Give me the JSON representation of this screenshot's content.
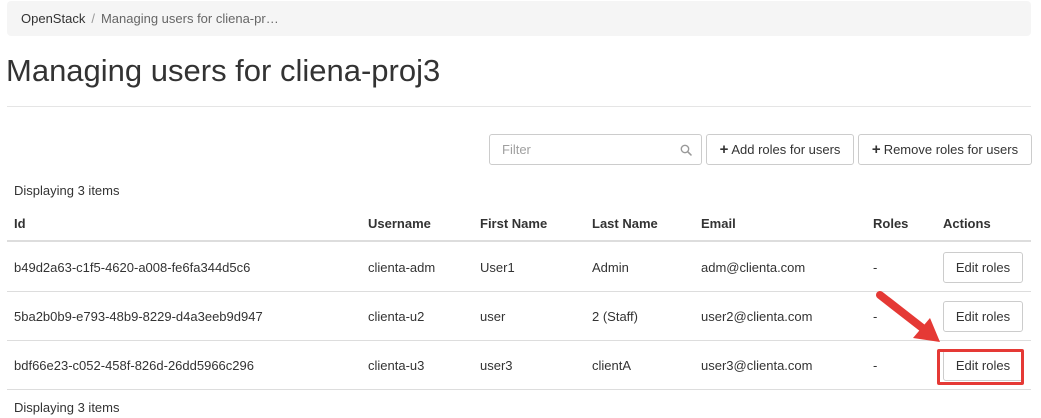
{
  "breadcrumb": {
    "root": "OpenStack",
    "separator": "/",
    "current": "Managing users for cliena-pr…"
  },
  "page_title": "Managing users for cliena-proj3",
  "toolbar": {
    "filter_placeholder": "Filter",
    "search_icon": "search-icon",
    "add_roles_label": "Add roles for users",
    "remove_roles_label": "Remove roles for users",
    "plus_glyph": "+"
  },
  "summary": {
    "top": "Displaying 3 items",
    "bottom": "Displaying 3 items"
  },
  "table": {
    "columns": [
      "Id",
      "Username",
      "First Name",
      "Last Name",
      "Email",
      "Roles",
      "Actions"
    ],
    "rows": [
      {
        "id": "b49d2a63-c1f5-4620-a008-fe6fa344d5c6",
        "username": "clienta-adm",
        "first_name": "User1",
        "last_name": "Admin",
        "email": "adm@clienta.com",
        "roles": "-",
        "action": "Edit roles"
      },
      {
        "id": "5ba2b0b9-e793-48b9-8229-d4a3eeb9d947",
        "username": "clienta-u2",
        "first_name": "user",
        "last_name": "2 (Staff)",
        "email": "user2@clienta.com",
        "roles": "-",
        "action": "Edit roles"
      },
      {
        "id": "bdf66e23-c052-458f-826d-26dd5966c296",
        "username": "clienta-u3",
        "first_name": "user3",
        "last_name": "clientA",
        "email": "user3@clienta.com",
        "roles": "-",
        "action": "Edit roles"
      }
    ]
  },
  "annotation": {
    "color": "#e53935",
    "highlighted_row": 3
  }
}
